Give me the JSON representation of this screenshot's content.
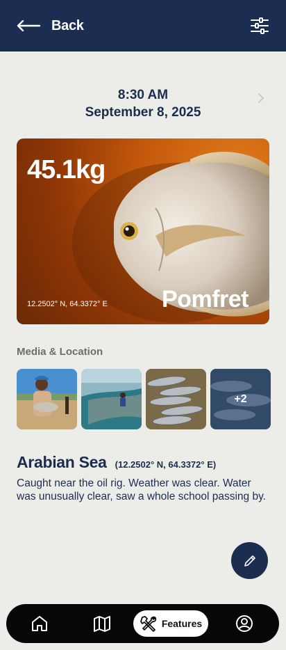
{
  "header": {
    "back_label": "Back",
    "back_icon": "arrow-left-icon",
    "filter_icon": "sliders-icon"
  },
  "entry": {
    "time": "8:30 AM",
    "date": "September 8, 2025",
    "weight": "45.1kg",
    "coords_small": "12.2502° N, 64.3372° E",
    "species": "Pomfret"
  },
  "media": {
    "section_label": "Media & Location",
    "more_label": "+2"
  },
  "location": {
    "name": "Arabian Sea",
    "coords": "(12.2502° N, 64.3372° E)",
    "notes": "Caught near the oil rig. Weather was clear. Water was unusually clear, saw a whole school passing by."
  },
  "tabbar": {
    "features_label": "Features",
    "icons": [
      "home-icon",
      "map-icon",
      "tools-icon",
      "profile-icon"
    ]
  },
  "colors": {
    "header_bg": "#1b2e52",
    "page_bg": "#ecede8",
    "text_primary": "#1b2d4f",
    "tabbar_bg": "#050709",
    "hero_orange": "#c55a0c"
  }
}
